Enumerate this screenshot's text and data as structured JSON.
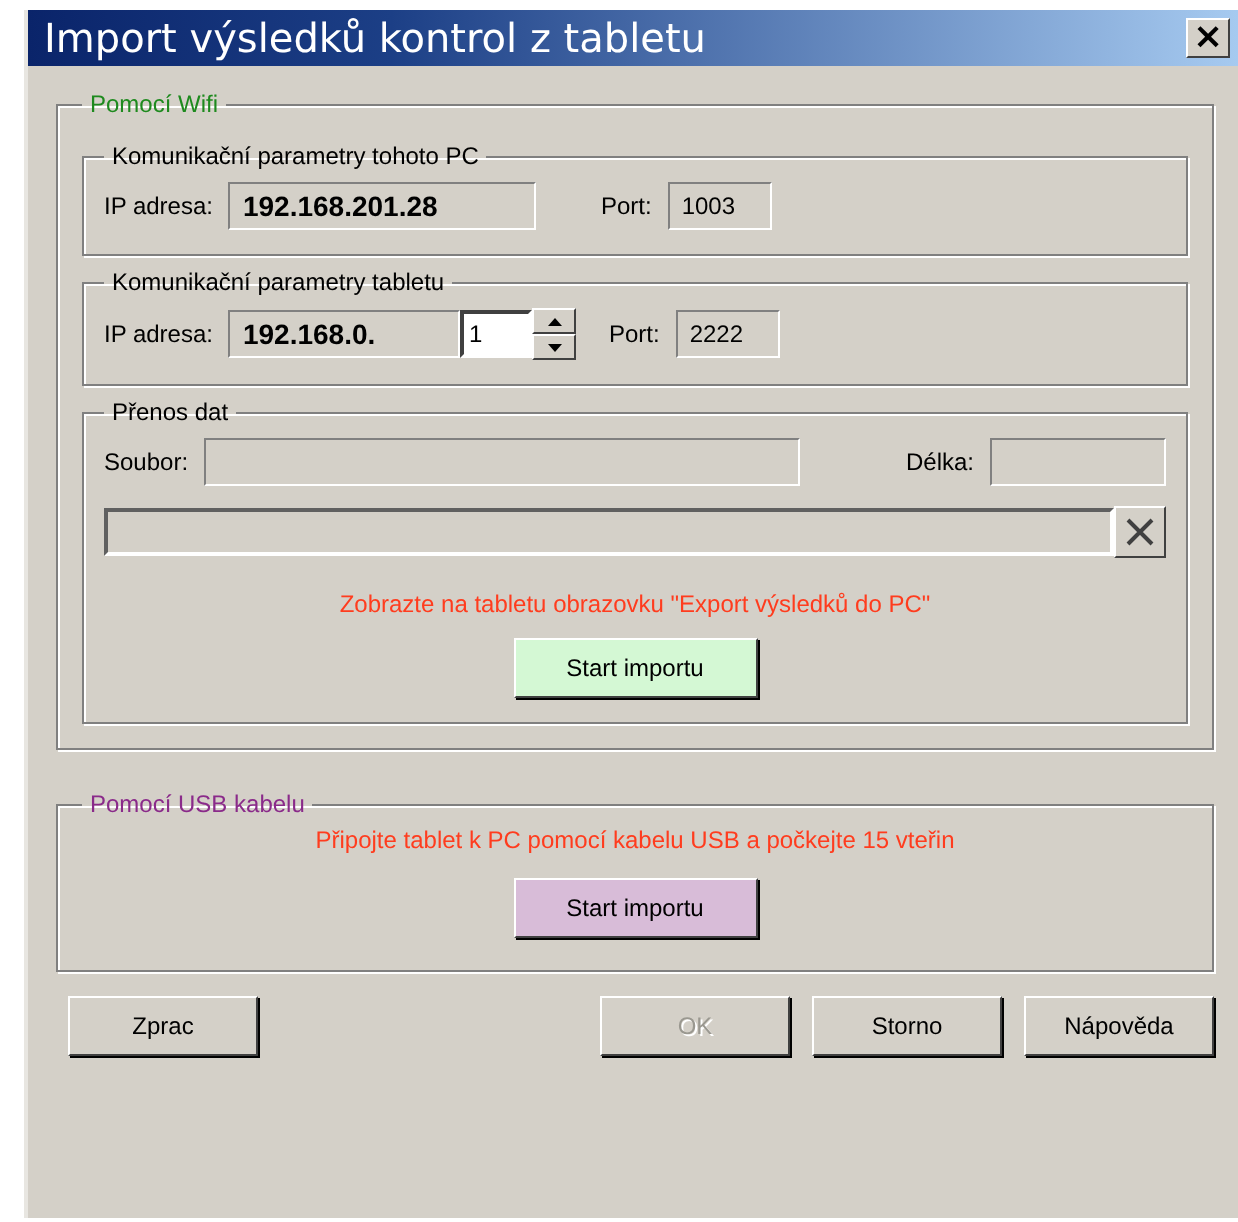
{
  "window": {
    "title": "Import výsledků kontrol z tabletu",
    "close": "×"
  },
  "wifi": {
    "title": "Pomocí Wifi",
    "pc": {
      "title": "Komunikační parametry tohoto PC",
      "ip_label": "IP adresa:",
      "ip": "192.168.201.28",
      "port_label": "Port:",
      "port": "1003"
    },
    "tablet": {
      "title": "Komunikační parametry tabletu",
      "ip_label": "IP adresa:",
      "ip_prefix": "192.168.0.",
      "ip_last": "1",
      "port_label": "Port:",
      "port": "2222"
    },
    "transfer": {
      "title": "Přenos dat",
      "file_label": "Soubor:",
      "length_label": "Délka:",
      "progress": {
        "level": 0
      },
      "message": "Zobrazte na tabletu obrazovku \"Export výsledků do PC\"",
      "button": "Start importu"
    }
  },
  "usb": {
    "title": "Pomocí USB kabelu",
    "message": "Připojte tablet k PC pomocí kabelu USB a počkejte 15 vteřin",
    "button": "Start importu"
  },
  "buttons": [
    {
      "label": "Zprac",
      "disabled": false
    },
    {
      "label": "OK",
      "disabled": true
    },
    {
      "label": "Storno",
      "disabled": false
    },
    {
      "label": "Nápověda",
      "disabled": false
    }
  ]
}
